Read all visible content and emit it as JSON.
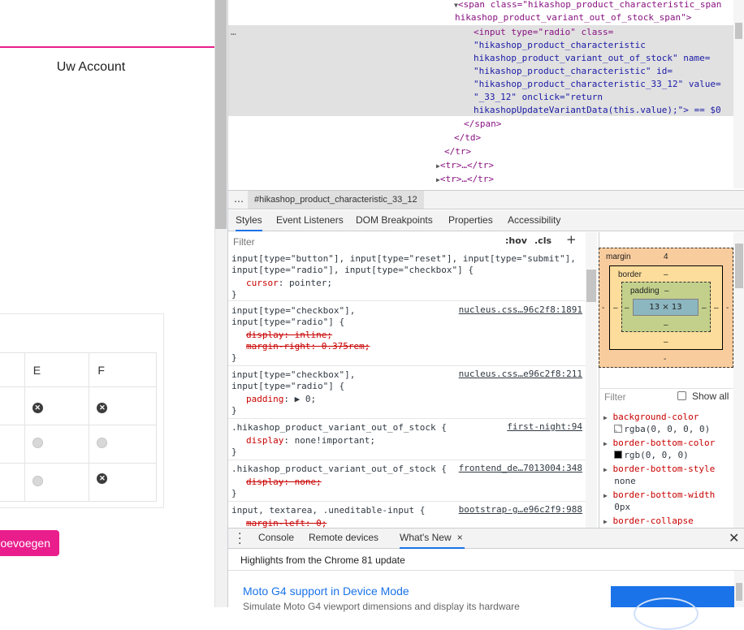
{
  "site": {
    "account_link": "Uw Account",
    "table": {
      "headers": [
        "",
        "E",
        "F"
      ],
      "rows": [
        {
          "e": "x",
          "f": "x"
        },
        {
          "e": "o",
          "f": "o"
        },
        {
          "e": "o",
          "f": "x"
        }
      ]
    },
    "add_button": "Toevoegen",
    "add_button_visible": "oevoegen"
  },
  "dom": {
    "lines": [
      {
        "indent": 0,
        "text": "<span class=\"hikashop_product_characteristic_span"
      },
      {
        "indent": 0,
        "text": "hikashop_product_variant_out_of_stock_span\">"
      },
      {
        "indent": 1,
        "text": "<input type=\"radio\" class="
      },
      {
        "indent": 1,
        "text": "\"hikashop_product_characteristic"
      },
      {
        "indent": 1,
        "text": "hikashop_product_variant_out_of_stock\" name="
      },
      {
        "indent": 1,
        "text": "\"hikashop_product_characteristic\" id="
      },
      {
        "indent": 1,
        "text": "\"hikashop_product_characteristic_33_12\" value="
      },
      {
        "indent": 1,
        "text": "\"_33_12\" onclick=\"return"
      },
      {
        "indent": 1,
        "text": "hikashopUpdateVariantData(this.value);\"> == $0"
      },
      {
        "indent": 0,
        "text": "</span>"
      },
      {
        "indent": 0,
        "text": "</td>"
      },
      {
        "indent": 0,
        "text": "</tr>"
      },
      {
        "indent": 0,
        "text": "<tr>…</tr>"
      },
      {
        "indent": 0,
        "text": "<tr>…</tr>"
      }
    ],
    "ellipsis": "…"
  },
  "breadcrumb": {
    "dots": "…",
    "selected": "#hikashop_product_characteristic_33_12"
  },
  "panel_tabs": [
    "Styles",
    "Event Listeners",
    "DOM Breakpoints",
    "Properties",
    "Accessibility"
  ],
  "styles": {
    "filter_placeholder": "Filter",
    "hov": ":hov",
    "cls": ".cls",
    "plus": "+",
    "rules": [
      {
        "selector": "input[type=\"button\"], input[type=\"reset\"], input[type=\"submit\"],",
        "selector2": "input[type=\"radio\"], input[type=\"checkbox\"] {",
        "source": "",
        "props": [
          {
            "name": "cursor",
            "value": "pointer;",
            "struck": false
          }
        ]
      },
      {
        "selector": "input[type=\"checkbox\"],",
        "selector2": "input[type=\"radio\"] {",
        "source": "nucleus.css…96c2f8:1891",
        "props": [
          {
            "name": "display",
            "value": "inline;",
            "struck": true
          },
          {
            "name": "margin-right",
            "value": "0.375rem;",
            "struck": true
          }
        ]
      },
      {
        "selector": "input[type=\"checkbox\"],",
        "selector2": "input[type=\"radio\"] {",
        "source": "nucleus.css…e96c2f8:211",
        "props": [
          {
            "name": "padding",
            "value": "▶ 0;",
            "struck": false
          }
        ]
      },
      {
        "selector": ".hikashop_product_variant_out_of_stock {",
        "selector2": "",
        "source": "first-night:94",
        "props": [
          {
            "name": "display",
            "value": "none!important;",
            "struck": false
          }
        ]
      },
      {
        "selector": ".hikashop_product_variant_out_of_stock {",
        "selector2": "",
        "source": "frontend_de…7013004:348",
        "props": [
          {
            "name": "display",
            "value": "none;",
            "struck": true
          }
        ]
      },
      {
        "selector": "input, textarea, .uneditable-input {",
        "selector2": "",
        "source": "bootstrap-g…e96c2f9:988",
        "props": [
          {
            "name": "margin-left",
            "value": "0;",
            "struck": true
          }
        ]
      }
    ]
  },
  "box_model": {
    "margin_label": "margin",
    "margin_top": "4",
    "margin_dash": "-",
    "border_label": "border",
    "padding_label": "padding",
    "content": "13 × 13",
    "dash": "–"
  },
  "computed": {
    "filter_placeholder": "Filter",
    "show_all": "Show all",
    "props": [
      {
        "name": "background-color",
        "value": "rgba(0, 0, 0, 0)",
        "swatch": "transparent"
      },
      {
        "name": "border-bottom-color",
        "value": "rgb(0, 0, 0)",
        "swatch": "#000000"
      },
      {
        "name": "border-bottom-style",
        "value": "none",
        "swatch": ""
      },
      {
        "name": "border-bottom-width",
        "value": "0px",
        "swatch": ""
      },
      {
        "name": "border-collapse",
        "value": "",
        "swatch": ""
      }
    ]
  },
  "drawer": {
    "tabs": [
      "Console",
      "Remote devices",
      "What's New"
    ],
    "close_tab": "×",
    "close": "✕",
    "highlights": "Highlights from the Chrome 81 update",
    "news_title": "Moto G4 support in Device Mode",
    "news_desc": "Simulate Moto G4 viewport dimensions and display its hardware"
  },
  "colors": {
    "brand": "#e91e8c",
    "accent": "#1a73e8"
  }
}
